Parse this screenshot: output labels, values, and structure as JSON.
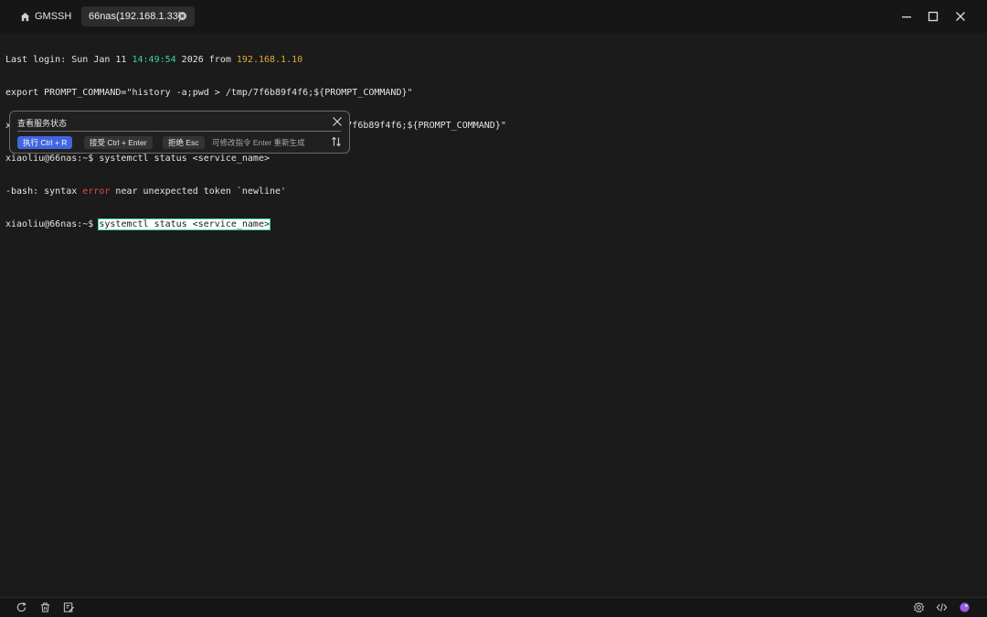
{
  "tabs": {
    "home_label": "GMSSH",
    "active_label": "66nas(192.168.1.33)"
  },
  "terminal": {
    "line1": {
      "prefix": "Last login: Sun Jan 11 ",
      "time": "14:49:54",
      "middle": " 2026 from ",
      "ip": "192.168.1.10"
    },
    "line2": "export PROMPT_COMMAND=\"history -a;pwd > /tmp/7f6b89f4f6;${PROMPT_COMMAND}\"",
    "line3": "xiaoliu@66nas:~$ export PROMPT_COMMAND=\"history -a;pwd > /tmp/7f6b89f4f6;${PROMPT_COMMAND}\"",
    "line4": "xiaoliu@66nas:~$ systemctl status <service_name>",
    "line5": {
      "prefix": "-bash: syntax ",
      "error": "error",
      "suffix": " near unexpected token `newline'"
    },
    "line6": {
      "prompt": "xiaoliu@66nas:~$ ",
      "selected": "systemctl status <service_name>"
    }
  },
  "ai_popup": {
    "query": "查看服务状态",
    "run_label": "执行 Ctrl + R",
    "accept_label": "接受 Ctrl + Enter",
    "reject_label": "拒绝 Esc",
    "hint": "可修改指令 Enter 重新生成"
  },
  "colors": {
    "time": "#3fd0a0",
    "ip": "#e2a93a",
    "error": "#e04a4a",
    "run_chip": "#4066e0",
    "selection_border": "#2fd3a5"
  },
  "icons": {
    "titlebar": [
      "home-icon",
      "close-icon",
      "minimize-icon",
      "maximize-icon",
      "window-close-icon"
    ],
    "popup": [
      "close-icon",
      "sort-arrows-icon"
    ],
    "statusbar": [
      "refresh-icon",
      "trash-icon",
      "edit-icon",
      "settings-icon",
      "code-icon",
      "ai-assistant-icon"
    ]
  }
}
